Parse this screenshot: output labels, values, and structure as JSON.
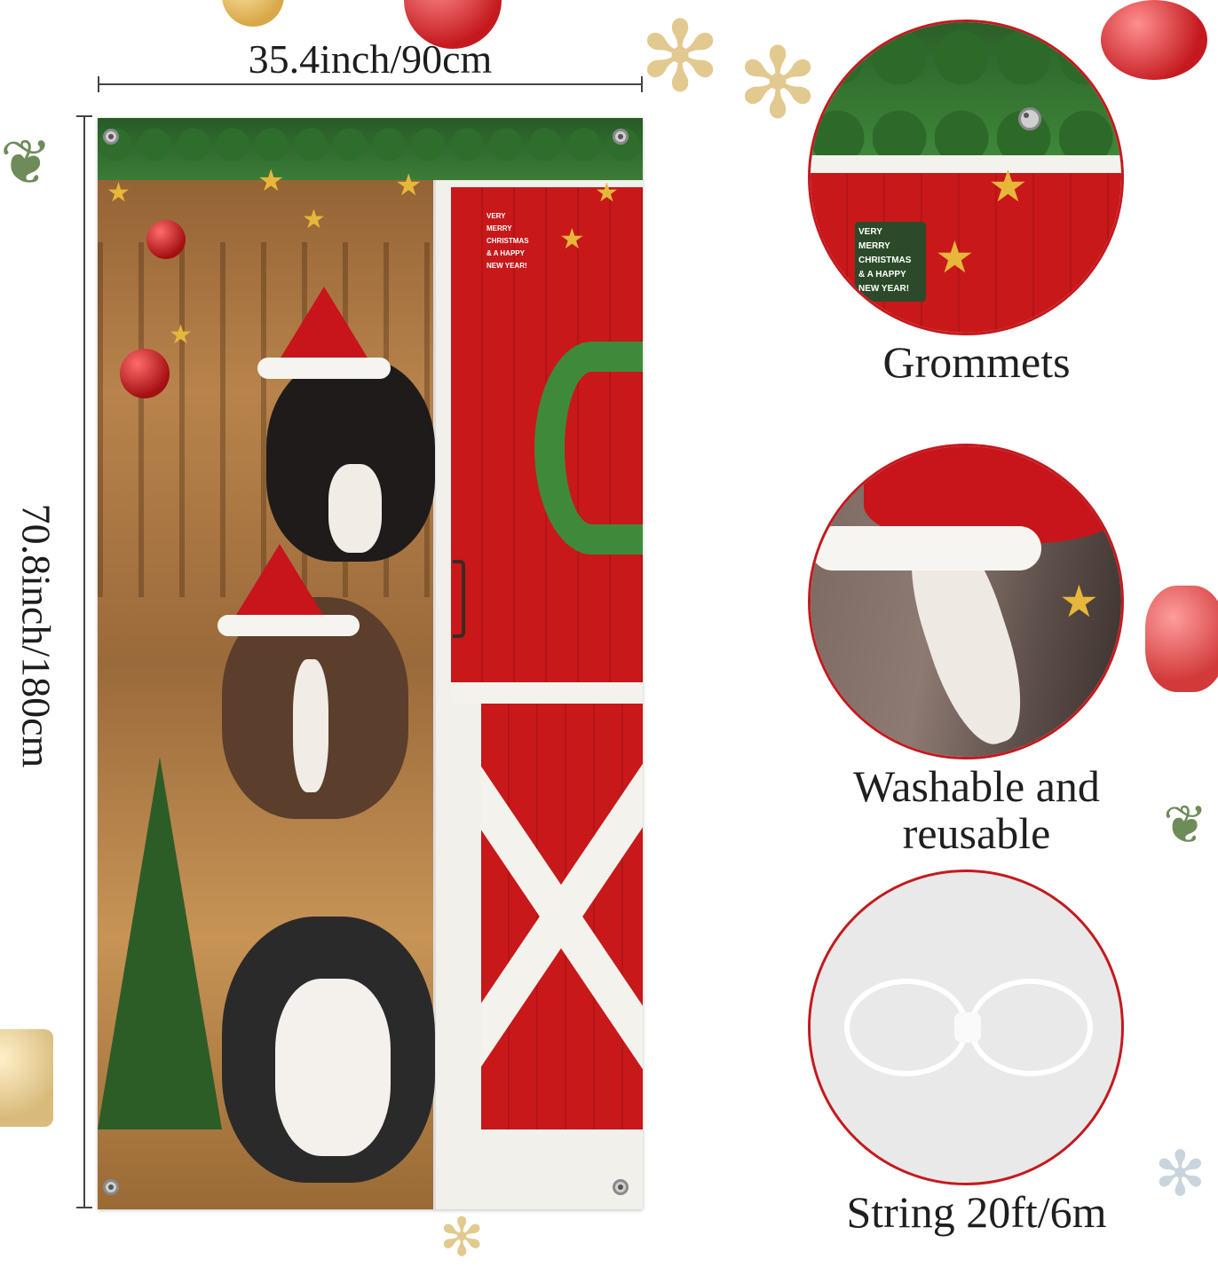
{
  "dimensions": {
    "width_label": "35.4inch/90cm",
    "height_label": "70.8inch/180cm"
  },
  "banner": {
    "door_sign": [
      "VERY",
      "MERRY",
      "CHRISTMAS",
      "& A HAPPY",
      "NEW YEAR!"
    ]
  },
  "features": [
    {
      "caption": "Grommets",
      "icon": "grommet-closeup"
    },
    {
      "caption_line1": "Washable and",
      "caption_line2": "reusable",
      "icon": "cow-face-closeup"
    },
    {
      "caption": "String 20ft/6m",
      "icon": "clear-string"
    }
  ],
  "colors": {
    "accent_red": "#c41a1f",
    "door_red": "#c8181a",
    "pine_green": "#3f8a3a",
    "gold": "#e6b73b"
  }
}
